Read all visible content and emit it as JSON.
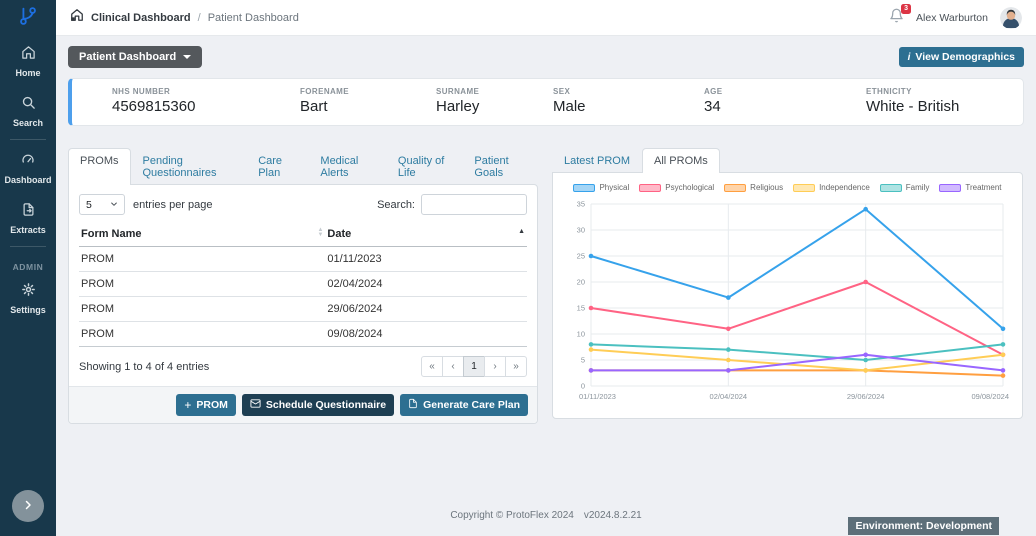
{
  "topbar": {
    "breadcrumb": {
      "root": "Clinical Dashboard",
      "separator": "/",
      "current": "Patient Dashboard"
    },
    "notification_count": "3",
    "user_name": "Alex Warburton"
  },
  "sidebar": {
    "items": [
      {
        "label": "Home",
        "icon": "home-icon"
      },
      {
        "label": "Search",
        "icon": "search-icon"
      },
      {
        "label": "Dashboard",
        "icon": "dashboard-icon"
      },
      {
        "label": "Extracts",
        "icon": "extracts-icon"
      }
    ],
    "section_label": "ADMIN",
    "admin_items": [
      {
        "label": "Settings",
        "icon": "gear-icon"
      }
    ]
  },
  "toolbar": {
    "dashboard_switcher_label": "Patient Dashboard",
    "view_demographics_label": "View Demographics"
  },
  "patient": {
    "fields": [
      {
        "label": "NHS NUMBER",
        "value": "4569815360"
      },
      {
        "label": "FORENAME",
        "value": "Bart"
      },
      {
        "label": "SURNAME",
        "value": "Harley"
      },
      {
        "label": "SEX",
        "value": "Male"
      },
      {
        "label": "AGE",
        "value": "34"
      },
      {
        "label": "ETHNICITY",
        "value": "White - British"
      }
    ]
  },
  "left_panel": {
    "tabs": [
      {
        "label": "PROMs",
        "active": true
      },
      {
        "label": "Pending Questionnaires",
        "active": false
      },
      {
        "label": "Care Plan",
        "active": false
      },
      {
        "label": "Medical Alerts",
        "active": false
      },
      {
        "label": "Quality of Life",
        "active": false
      },
      {
        "label": "Patient Goals",
        "active": false
      }
    ],
    "entries_per_page": {
      "selected": "5",
      "label": "entries per page"
    },
    "search_label": "Search:",
    "table": {
      "columns": [
        {
          "label": "Form Name"
        },
        {
          "label": "Date"
        }
      ],
      "rows": [
        {
          "form_name": "PROM",
          "date": "01/11/2023"
        },
        {
          "form_name": "PROM",
          "date": "02/04/2024"
        },
        {
          "form_name": "PROM",
          "date": "29/06/2024"
        },
        {
          "form_name": "PROM",
          "date": "09/08/2024"
        }
      ]
    },
    "summary": "Showing 1 to 4 of 4 entries",
    "pagination": {
      "first": "«",
      "prev": "‹",
      "page": "1",
      "next": "›",
      "last": "»"
    },
    "actions": [
      {
        "label": "PROM",
        "icon": "plus-icon",
        "style": "teal"
      },
      {
        "label": "Schedule Questionnaire",
        "icon": "envelope-icon",
        "style": "navy"
      },
      {
        "label": "Generate Care Plan",
        "icon": "file-icon",
        "style": "teal"
      }
    ]
  },
  "right_panel": {
    "tabs": [
      {
        "label": "Latest PROM",
        "active": false
      },
      {
        "label": "All PROMs",
        "active": true
      }
    ]
  },
  "chart_data": {
    "type": "line",
    "x": [
      "01/11/2023",
      "02/04/2024",
      "29/06/2024",
      "09/08/2024"
    ],
    "series": [
      {
        "name": "Physical",
        "color": "#36a2eb",
        "values": [
          25,
          17,
          34,
          11
        ]
      },
      {
        "name": "Psychological",
        "color": "#ff6384",
        "values": [
          15,
          11,
          20,
          6
        ]
      },
      {
        "name": "Religious",
        "color": "#ff9f40",
        "values": [
          3,
          3,
          3,
          2
        ]
      },
      {
        "name": "Independence",
        "color": "#ffcd56",
        "values": [
          7,
          5,
          3,
          6
        ]
      },
      {
        "name": "Family",
        "color": "#4bc0c0",
        "values": [
          8,
          7,
          5,
          8
        ]
      },
      {
        "name": "Treatment",
        "color": "#9966ff",
        "values": [
          3,
          3,
          6,
          3
        ]
      }
    ],
    "ylim": [
      0,
      35
    ],
    "ytick_step": 5,
    "legend_position": "top",
    "grid": true
  },
  "footer": {
    "copyright": "Copyright © ProtoFlex 2024",
    "version": "v2024.8.2.21"
  },
  "environment": {
    "label": "Environment: Development"
  },
  "colors": {
    "sidebar_bg": "#18384b",
    "accent_teal": "#2d6f91",
    "dark_navy_button": "#1e3f53",
    "banner_accent": "#4d9fec",
    "notification_red": "#dc3545",
    "logo_blue": "#1d6fe0"
  }
}
